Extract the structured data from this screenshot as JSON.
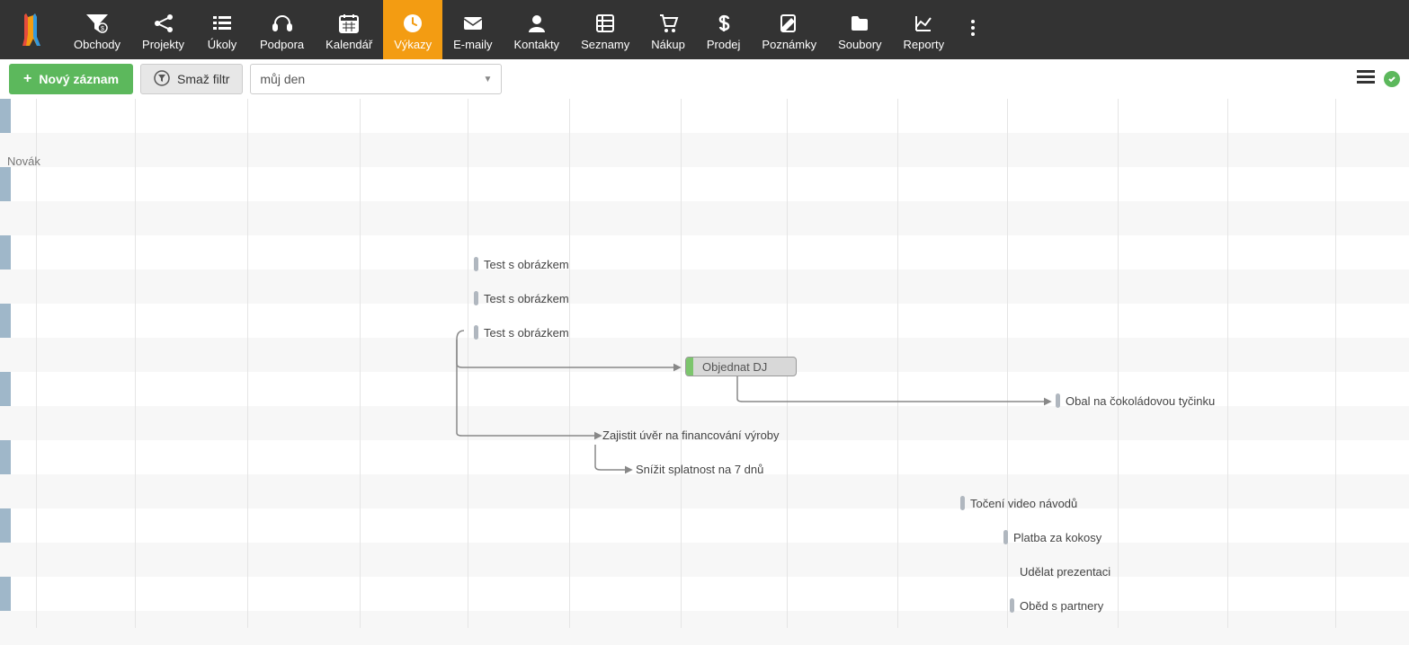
{
  "nav": {
    "items": [
      {
        "label": "Obchody",
        "icon": "funnel"
      },
      {
        "label": "Projekty",
        "icon": "share"
      },
      {
        "label": "Úkoly",
        "icon": "checklist"
      },
      {
        "label": "Podpora",
        "icon": "headset"
      },
      {
        "label": "Kalendář",
        "icon": "calendar"
      },
      {
        "label": "Výkazy",
        "icon": "clock",
        "active": true
      },
      {
        "label": "E-maily",
        "icon": "envelope"
      },
      {
        "label": "Kontakty",
        "icon": "person"
      },
      {
        "label": "Seznamy",
        "icon": "list-grid"
      },
      {
        "label": "Nákup",
        "icon": "cart"
      },
      {
        "label": "Prodej",
        "icon": "dollar"
      },
      {
        "label": "Poznámky",
        "icon": "edit"
      },
      {
        "label": "Soubory",
        "icon": "folder"
      },
      {
        "label": "Reporty",
        "icon": "chart"
      }
    ]
  },
  "toolbar": {
    "new_label": "Nový záznam",
    "clear_label": "Smaž filtr",
    "filter_value": "můj den"
  },
  "gantt": {
    "user_label": "Novák",
    "tasks": [
      {
        "label": "Test s obrázkem"
      },
      {
        "label": "Test s obrázkem"
      },
      {
        "label": "Test s obrázkem"
      },
      {
        "label": "Objednat DJ"
      },
      {
        "label": "Obal na čokoládovou tyčinku"
      },
      {
        "label": "Zajistit úvěr na financování výroby"
      },
      {
        "label": "Snížit splatnost na 7 dnů"
      },
      {
        "label": "Točení video návodů"
      },
      {
        "label": "Platba za kokosy"
      },
      {
        "label": "Udělat prezentaci"
      },
      {
        "label": "Oběd s partnery"
      }
    ]
  }
}
